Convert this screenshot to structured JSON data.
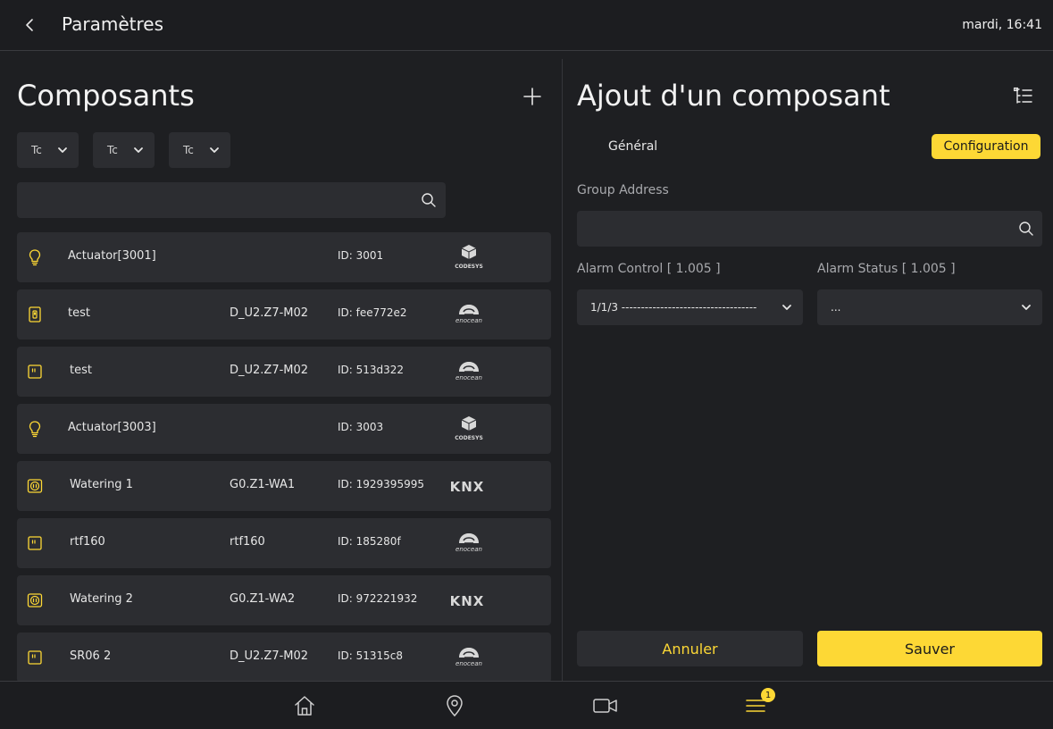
{
  "header": {
    "title": "Paramètres",
    "clock": "mardi, 16:41"
  },
  "left": {
    "title": "Composants",
    "filters": [
      "Tc",
      "Tc",
      "Tc"
    ],
    "search": {
      "placeholder": ""
    },
    "rows": [
      {
        "icon": "bulb-icon",
        "name": "Actuator[3001]",
        "address": "",
        "id": "ID: 3001",
        "brand": "CODESYS"
      },
      {
        "icon": "switch-icon",
        "name": "test",
        "address": "D_U2.Z7-M02",
        "id": "ID: fee772e2",
        "brand": "enocean"
      },
      {
        "icon": "switch-panel-icon",
        "name": "test",
        "address": "D_U2.Z7-M02",
        "id": "ID: 513d322",
        "brand": "enocean"
      },
      {
        "icon": "bulb-icon",
        "name": "Actuator[3003]",
        "address": "",
        "id": "ID: 3003",
        "brand": "CODESYS"
      },
      {
        "icon": "socket-icon",
        "name": "Watering 1",
        "address": "G0.Z1-WA1",
        "id": "ID: 1929395995",
        "brand": "KNX"
      },
      {
        "icon": "switch-panel-icon",
        "name": "rtf160",
        "address": "rtf160",
        "id": "ID: 185280f",
        "brand": "enocean"
      },
      {
        "icon": "socket-icon",
        "name": "Watering 2",
        "address": "G0.Z1-WA2",
        "id": "ID: 972221932",
        "brand": "KNX"
      },
      {
        "icon": "switch-panel-icon",
        "name": "SR06 2",
        "address": "D_U2.Z7-M02",
        "id": "ID: 51315c8",
        "brand": "enocean"
      }
    ]
  },
  "right": {
    "title": "Ajout d'un composant",
    "tabs": {
      "general": "Général",
      "configuration": "Configuration"
    },
    "group_address_label": "Group Address",
    "alarm_control_label": "Alarm Control [ 1.005 ]",
    "alarm_control_value": "1/1/3 -----------------------------------",
    "alarm_status_label": "Alarm Status [ 1.005 ]",
    "alarm_status_value": "...",
    "cancel_label": "Annuler",
    "save_label": "Sauver"
  },
  "nav": {
    "badge": "1"
  },
  "colors": {
    "accent": "#fdd835",
    "panel": "#2c2d31",
    "background": "#1e1f22"
  }
}
